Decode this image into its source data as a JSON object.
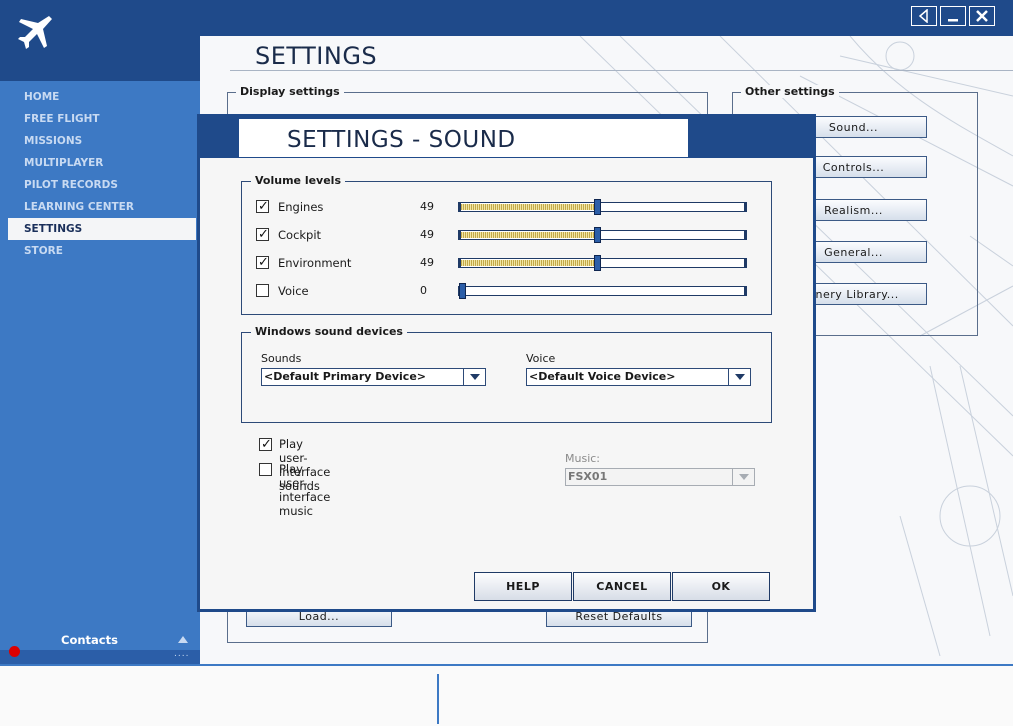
{
  "window": {
    "controls": [
      "sound-toggle",
      "minimize",
      "close"
    ]
  },
  "sidebar": {
    "items": [
      {
        "label": "HOME"
      },
      {
        "label": "FREE FLIGHT"
      },
      {
        "label": "MISSIONS"
      },
      {
        "label": "MULTIPLAYER"
      },
      {
        "label": "PILOT RECORDS"
      },
      {
        "label": "LEARNING CENTER"
      },
      {
        "label": "SETTINGS",
        "active": true
      },
      {
        "label": "STORE"
      }
    ],
    "contacts_label": "Contacts",
    "contacts_dots": "....",
    "status_color": "#dd0000"
  },
  "page": {
    "title": "SETTINGS",
    "display_group_label": "Display settings",
    "other_group_label": "Other settings",
    "other_buttons": [
      "Sound...",
      "Controls...",
      "Realism...",
      "General...",
      "enery Library..."
    ],
    "load_button": "Load...",
    "reset_button": "Reset Defaults"
  },
  "dialog": {
    "title": "SETTINGS - SOUND",
    "volume_group_label": "Volume levels",
    "volume": [
      {
        "label": "Engines",
        "checked": true,
        "value": "49",
        "level": 0.49
      },
      {
        "label": "Cockpit",
        "checked": true,
        "value": "49",
        "level": 0.49
      },
      {
        "label": "Environment",
        "checked": true,
        "value": "49",
        "level": 0.49
      },
      {
        "label": "Voice",
        "checked": false,
        "value": "0",
        "level": 0.0
      }
    ],
    "devices_group_label": "Windows sound devices",
    "sounds_label": "Sounds",
    "sounds_value": "<Default Primary Device>",
    "voice_label": "Voice",
    "voice_value": "<Default Voice Device>",
    "ui_sounds": {
      "label": "Play user-interface sounds",
      "checked": true
    },
    "ui_music": {
      "label": "Play user-interface music",
      "checked": false
    },
    "music_label": "Music:",
    "music_value": "FSX01",
    "buttons": {
      "help": "HELP",
      "cancel": "CANCEL",
      "ok": "OK"
    }
  },
  "colors": {
    "primary_dark": "#1f4a8a",
    "sidebar": "#3d79c4",
    "slider_fill": "#c3a94a"
  }
}
